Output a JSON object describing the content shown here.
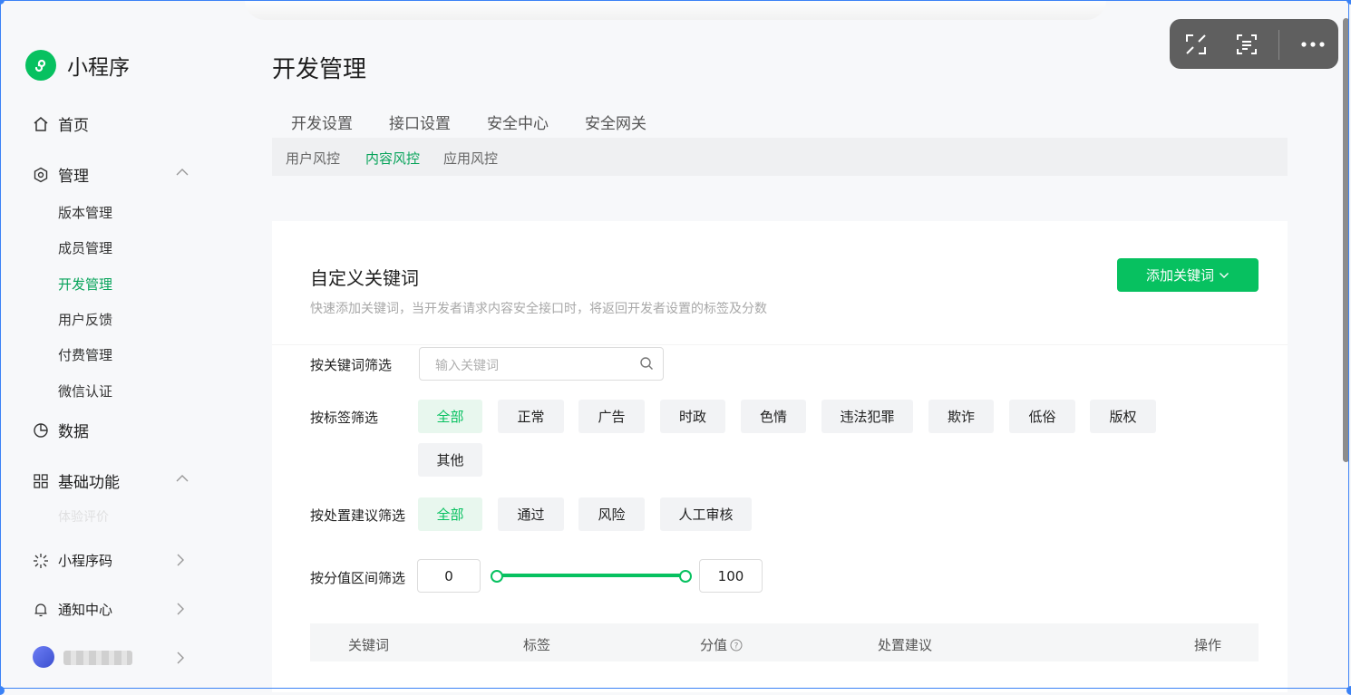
{
  "app": {
    "name": "小程序",
    "brand_color": "#07c160"
  },
  "sidebar": {
    "home": "首页",
    "manage": {
      "label": "管理",
      "items": [
        "版本管理",
        "成员管理",
        "开发管理",
        "用户反馈",
        "付费管理",
        "微信认证"
      ],
      "active": "开发管理"
    },
    "data": "数据",
    "basic": {
      "label": "基础功能",
      "faded_item": "体验评价"
    },
    "qrcode": "小程序码",
    "notify": "通知中心"
  },
  "page": {
    "title": "开发管理"
  },
  "tabs": [
    "开发设置",
    "接口设置",
    "安全中心",
    "安全网关"
  ],
  "subtabs": {
    "items": [
      "用户风控",
      "内容风控",
      "应用风控"
    ],
    "active": "内容风控"
  },
  "card": {
    "title": "自定义关键词",
    "desc": "快速添加关键词，当开发者请求内容安全接口时，将返回开发者设置的标签及分数",
    "add_button": "添加关键词",
    "filters": {
      "keyword_label": "按关键词筛选",
      "keyword_placeholder": "输入关键词",
      "tag_label": "按标签筛选",
      "tags": [
        "全部",
        "正常",
        "广告",
        "时政",
        "色情",
        "违法犯罪",
        "欺诈",
        "低俗",
        "版权",
        "其他"
      ],
      "tag_selected": "全部",
      "suggest_label": "按处置建议筛选",
      "suggestions": [
        "全部",
        "通过",
        "风险",
        "人工审核"
      ],
      "suggest_selected": "全部",
      "score_label": "按分值区间筛选",
      "score_min": "0",
      "score_max": "100",
      "score_range": [
        0,
        100
      ]
    },
    "table": {
      "headers": [
        "关键词",
        "标签",
        "分值",
        "处置建议",
        "操作"
      ]
    }
  },
  "toolbar": {
    "icons": [
      "expand-icon",
      "scan-text-icon",
      "more-icon"
    ]
  }
}
